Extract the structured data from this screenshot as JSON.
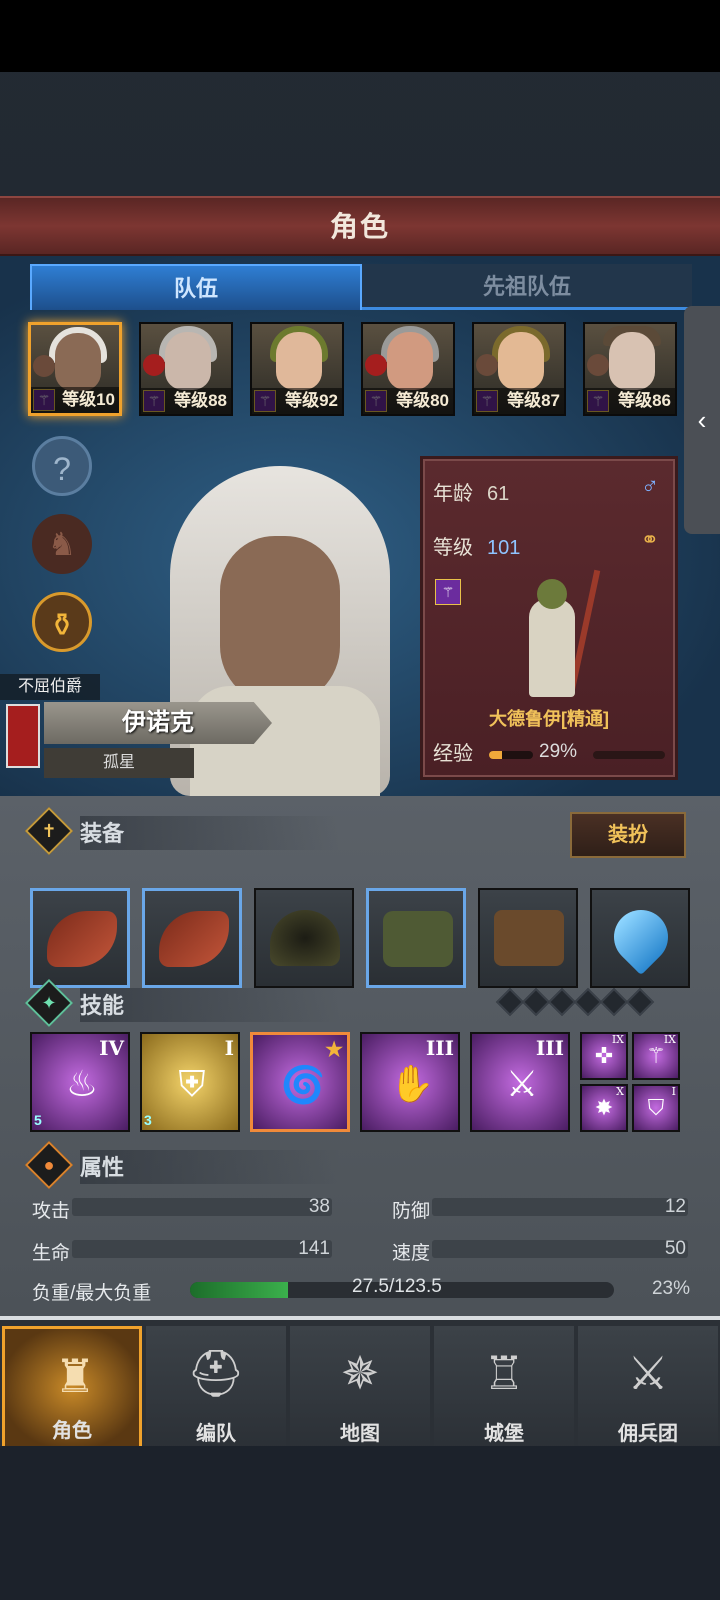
{
  "title": "角色",
  "tabs": [
    {
      "label": "队伍"
    },
    {
      "label": "先祖队伍"
    }
  ],
  "party": [
    {
      "level_text": "等级10",
      "selected": true
    },
    {
      "level_text": "等级88"
    },
    {
      "level_text": "等级92"
    },
    {
      "level_text": "等级80"
    },
    {
      "level_text": "等级87"
    },
    {
      "level_text": "等级86"
    }
  ],
  "hero": {
    "title": "不屈伯爵",
    "name": "伊诺克",
    "trait": "孤星"
  },
  "info": {
    "age_label": "年龄",
    "age": "61",
    "level_label": "等级",
    "level": "101",
    "class_name": "大德鲁伊[精通]",
    "exp_label": "经验",
    "exp_percent": "29%",
    "exp_fraction": 0.29
  },
  "equipment": {
    "label": "装备",
    "dress_button": "装扮",
    "items": [
      "fur-claw-1",
      "fur-claw-2",
      "hood",
      "green-tunic",
      "leather-boots",
      "blue-heart-amulet"
    ]
  },
  "skills": {
    "label": "技能",
    "items": [
      {
        "rank": "IV",
        "badge": "5"
      },
      {
        "rank": "I",
        "badge": "3"
      },
      {
        "rank": "★",
        "badge": ""
      },
      {
        "rank": "III",
        "badge": ""
      },
      {
        "rank": "III",
        "badge": ""
      }
    ],
    "mini": [
      {
        "rank": "IX"
      },
      {
        "rank": "IX"
      },
      {
        "rank": "X"
      },
      {
        "rank": "I"
      }
    ]
  },
  "attributes": {
    "label": "属性",
    "attack_label": "攻击",
    "attack": "38",
    "defense_label": "防御",
    "defense": "12",
    "hp_label": "生命",
    "hp": "141",
    "speed_label": "速度",
    "speed": "50",
    "load_label": "负重/最大负重",
    "load": "27.5/123.5",
    "load_percent": "23%",
    "load_fraction": 0.23
  },
  "nav": [
    {
      "label": "角色",
      "active": true
    },
    {
      "label": "编队"
    },
    {
      "label": "地图"
    },
    {
      "label": "城堡"
    },
    {
      "label": "佣兵团"
    }
  ],
  "colors": {
    "accent": "#f0a22c",
    "tab_active": "#2f7ed3",
    "panel_red": "#5b2a2e"
  }
}
